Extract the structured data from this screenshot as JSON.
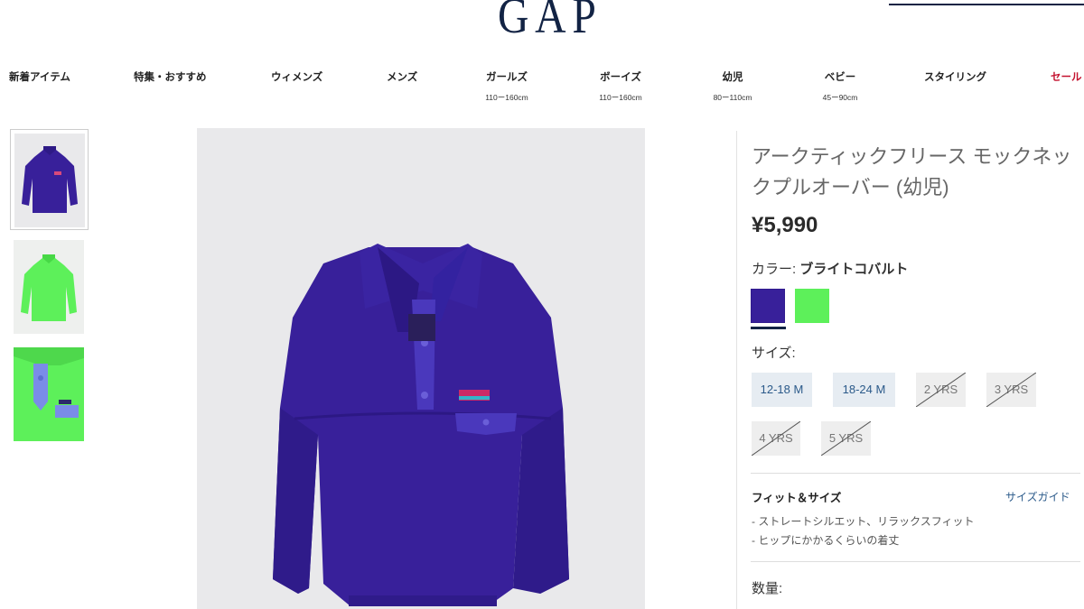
{
  "header": {
    "logo": "GAP"
  },
  "nav": [
    {
      "label": "新着アイテム",
      "sub": ""
    },
    {
      "label": "特集・おすすめ",
      "sub": ""
    },
    {
      "label": "ウィメンズ",
      "sub": ""
    },
    {
      "label": "メンズ",
      "sub": ""
    },
    {
      "label": "ガールズ",
      "sub": "110ー160cm"
    },
    {
      "label": "ボーイズ",
      "sub": "110ー160cm"
    },
    {
      "label": "幼児",
      "sub": "80ー110cm"
    },
    {
      "label": "ベビー",
      "sub": "45ー90cm"
    },
    {
      "label": "スタイリング",
      "sub": ""
    },
    {
      "label": "セール",
      "sub": ""
    }
  ],
  "product": {
    "title": "アークティックフリース モックネックプルオーバー (幼児)",
    "price": "¥5,990",
    "color_label": "カラー:",
    "color_name": "ブライトコバルト",
    "swatches": [
      {
        "name": "ブライトコバルト",
        "color": "#38209a"
      },
      {
        "name": "green",
        "color": "#5df05a"
      }
    ],
    "size_label": "サイズ:",
    "sizes": [
      {
        "label": "12-18 M",
        "available": true
      },
      {
        "label": "18-24 M",
        "available": true
      },
      {
        "label": "2 YRS",
        "available": false
      },
      {
        "label": "3 YRS",
        "available": false
      },
      {
        "label": "4 YRS",
        "available": false
      },
      {
        "label": "5 YRS",
        "available": false
      }
    ],
    "fit_title": "フィット＆サイズ",
    "size_guide": "サイズガイド",
    "fit_lines": [
      "- ストレートシルエット、リラックスフィット",
      "- ヒップにかかるくらいの着丈"
    ],
    "qty_label": "数量:"
  },
  "colors": {
    "brand_navy": "#122344",
    "sale_red": "#c4122f",
    "link_blue": "#2b5a8a",
    "fleece_cobalt": "#38209a",
    "fleece_green": "#5df05a"
  }
}
